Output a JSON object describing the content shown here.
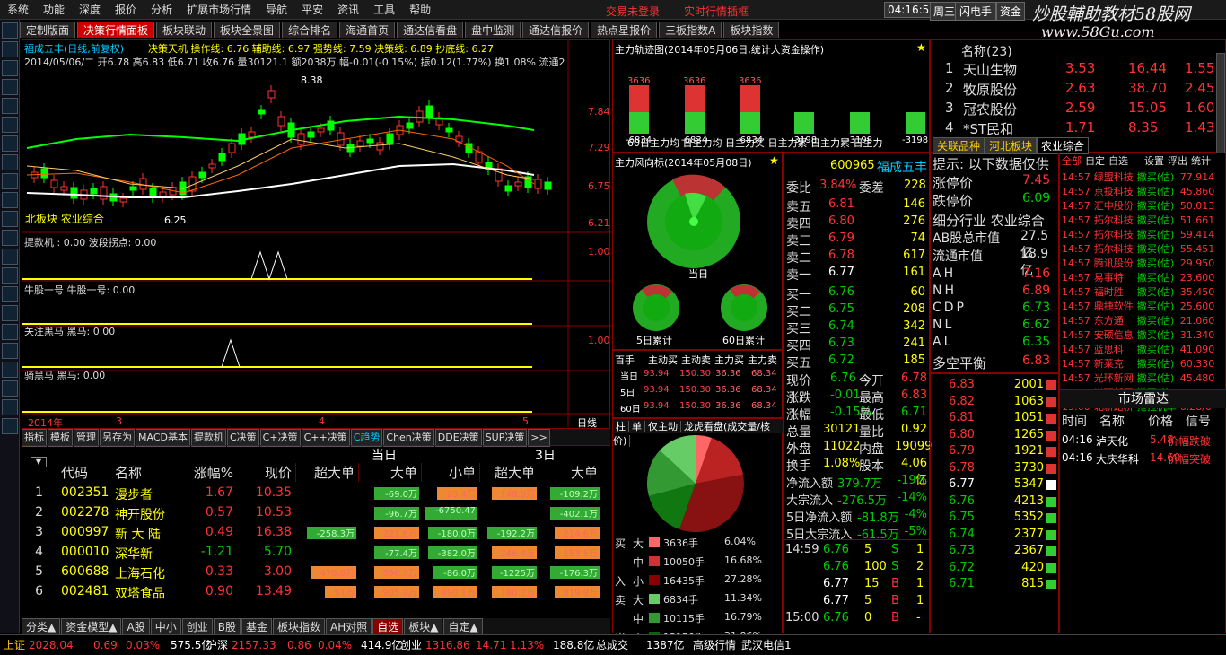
{
  "menu": [
    "系统",
    "功能",
    "深度",
    "报价",
    "分析",
    "扩展市场行情",
    "导航",
    "平安",
    "资讯",
    "工具",
    "帮助"
  ],
  "menu_red": [
    "交易未登录",
    "实时行情插框"
  ],
  "clock": "04:16:57",
  "weekday": "周三",
  "btn_flash": "闪电手",
  "btn_zi": "资金",
  "logo": "炒股輔助教材58股网",
  "logo_url": "www.58Gu.com",
  "tabs": [
    "定制版面",
    "决策行情面板",
    "板块联动",
    "板块全景图",
    "综合排名",
    "海通首页",
    "通达信看盘",
    "盘中监测",
    "通达信报价",
    "热点星报价",
    "三板指数A",
    "板块指数"
  ],
  "chart": {
    "title": "福成五丰(日线,前复权)",
    "indicators": "决策天机 操作线: 6.76 辅助线: 6.97 强势线: 7.59 决策线: 6.89 抄底线: 6.27",
    "info": "2014/05/06/二 开6.78 高6.83 低6.71 收6.76 量30121.1 额2038万 幅-0.01(-0.15%) 振0.12(1.77%) 换1.08% 流通2",
    "hi_label": "8.38",
    "lo_label": "6.25",
    "sector": "北板块 农业综合",
    "yticks": [
      "7.84",
      "7.29",
      "6.75",
      "6.21"
    ],
    "ind1": "提款机 : 0.00 波段拐点: 0.00",
    "ind1_tick": "1.00",
    "ind2": "牛股一号 牛股一号: 0.00",
    "ind3": "关注黑马 黑马: 0.00",
    "ind3_tick": "1.00",
    "ind4": "骑黑马 黑马: 0.00",
    "xlabels": [
      "2014年",
      "3",
      "4",
      "5"
    ],
    "period": "日线"
  },
  "bottom_tabs": [
    "指标",
    "模板",
    "管理",
    "另存为",
    "MACD基本",
    "提款机",
    "C决策",
    "C+决策",
    "C++决策",
    "C趋势",
    "Chen决策",
    "DDE决策",
    "SUP决策",
    ">>"
  ],
  "table": {
    "headers": [
      "代码",
      "名称",
      "涨幅%",
      "现价",
      "超大单",
      "大单",
      "小单",
      "超大单",
      "大单"
    ],
    "group_today": "当日",
    "group_3d": "3日",
    "rows": [
      {
        "n": "1",
        "code": "002351",
        "name": "漫步者",
        "pct": "1.67",
        "price": "10.35",
        "a": "",
        "b": "-69.0万",
        "c": "23.4万",
        "d": "148.0万",
        "e": "-109.2万"
      },
      {
        "n": "2",
        "code": "002278",
        "name": "神开股份",
        "pct": "0.57",
        "price": "10.53",
        "a": "",
        "b": "-96.7万",
        "c": "-6750.47",
        "d": "",
        "e": "-402.1万"
      },
      {
        "n": "3",
        "code": "000997",
        "name": "新 大 陆",
        "pct": "0.49",
        "price": "16.38",
        "a": "-258.3万",
        "b": "221.8万",
        "c": "-180.0万",
        "d": "-192.2万",
        "e": "214.6万"
      },
      {
        "n": "4",
        "code": "000010",
        "name": "深华新",
        "pct": "-1.21",
        "price": "5.70",
        "a": "",
        "b": "-77.4万",
        "c": "-382.0万",
        "d": "246.4万",
        "e": "153.5万"
      },
      {
        "n": "5",
        "code": "600688",
        "name": "上海石化",
        "pct": "0.33",
        "price": "3.00",
        "a": "470.0万",
        "b": "396.3万",
        "c": "-86.0万",
        "d": "-1225万",
        "e": "-176.3万"
      },
      {
        "n": "6",
        "code": "002481",
        "name": "双塔食品",
        "pct": "0.90",
        "price": "13.49",
        "a": "51万",
        "b": "905.2万",
        "c": "490.1万",
        "d": "180.2万",
        "e": "819.9万"
      }
    ]
  },
  "sheet_tabs": [
    "分类▲",
    "资金模型▲",
    "A股",
    "中小",
    "创业",
    "B股",
    "基金",
    "板块指数",
    "AH对照",
    "自选",
    "板块▲",
    "自定▲"
  ],
  "mainforce": {
    "title": "主力轨迹图(2014年05月06日,统计大资金操作)",
    "bars": [
      {
        "top": "3636",
        "bot": "-6834"
      },
      {
        "top": "3636",
        "bot": "-6834"
      },
      {
        "top": "3636",
        "bot": "-6834"
      },
      {
        "top": "",
        "bot": "-3198"
      },
      {
        "top": "",
        "bot": "-3198"
      },
      {
        "top": "",
        "bot": "-3198"
      }
    ],
    "labels": "60日主力均 日主力均 日主力买 日主力累 日主力累 日主力"
  },
  "wind": {
    "title": "主力风向标(2014年05月08日)",
    "today": "当日",
    "d5": "5日累计",
    "d60": "60日累计"
  },
  "flow_table": {
    "headers": [
      "百手",
      "主动买",
      "主动卖",
      "主力买",
      "主力卖"
    ],
    "rows": [
      [
        "当日",
        "93.94",
        "150.30",
        "36.36",
        "68.34"
      ],
      [
        "5日",
        "93.94",
        "150.30",
        "36.36",
        "68.34"
      ],
      [
        "60日",
        "93.94",
        "150.30",
        "36.36",
        "68.34"
      ]
    ]
  },
  "pie_tabs": [
    "柱",
    "单",
    "仅主动",
    "龙虎看盘(成交量/核价)"
  ],
  "pie_legend": [
    {
      "s": "买",
      "k": "大",
      "v": "3636手",
      "p": "6.04%",
      "c": "#f66"
    },
    {
      "s": "",
      "k": "中",
      "v": "10050手",
      "p": "16.68%",
      "c": "#c33"
    },
    {
      "s": "入",
      "k": "小",
      "v": "16435手",
      "p": "27.28%",
      "c": "#800"
    },
    {
      "s": "卖",
      "k": "大",
      "v": "6834手",
      "p": "11.34%",
      "c": "#6c6"
    },
    {
      "s": "",
      "k": "中",
      "v": "10115手",
      "p": "16.79%",
      "c": "#393"
    },
    {
      "s": "出",
      "k": "小",
      "v": "13170手",
      "p": "21.86%",
      "c": "#060"
    }
  ],
  "quote": {
    "code": "600965",
    "name": "福成五丰",
    "wb": "3.84%",
    "wc": "228",
    "sell": [
      [
        "卖五",
        "6.81",
        "146"
      ],
      [
        "卖四",
        "6.80",
        "276"
      ],
      [
        "卖三",
        "6.79",
        "74"
      ],
      [
        "卖二",
        "6.78",
        "617"
      ],
      [
        "卖一",
        "6.77",
        "161"
      ]
    ],
    "buy": [
      [
        "买一",
        "6.76",
        "60"
      ],
      [
        "买二",
        "6.75",
        "208"
      ],
      [
        "买三",
        "6.74",
        "342"
      ],
      [
        "买四",
        "6.73",
        "241"
      ],
      [
        "买五",
        "6.72",
        "185"
      ]
    ],
    "stats": [
      [
        "现价",
        "6.76",
        "今开",
        "6.78"
      ],
      [
        "涨跌",
        "-0.01",
        "最高",
        "6.83"
      ],
      [
        "涨幅",
        "-0.15%",
        "最低",
        "6.71"
      ],
      [
        "总量",
        "30121",
        "量比",
        "0.92"
      ],
      [
        "外盘",
        "11022",
        "内盘",
        "19099"
      ],
      [
        "换手",
        "1.08%",
        "股本",
        "4.06亿"
      ]
    ],
    "flows": [
      [
        "净流入额",
        "379.7万",
        "-19%"
      ],
      [
        "大宗流入",
        "-276.5万",
        "-14%"
      ],
      [
        "5日净流入额",
        "-81.8万",
        "-4%"
      ],
      [
        "5日大宗流入",
        "-61.5万",
        "-5%"
      ]
    ],
    "ticks": [
      [
        "14:59",
        "6.76",
        "5",
        "S",
        "1"
      ],
      [
        "",
        "6.76",
        "100",
        "S",
        "2"
      ],
      [
        "",
        "6.77",
        "15",
        "B",
        "1"
      ],
      [
        "",
        "6.77",
        "5",
        "B",
        "1"
      ],
      [
        "15:00",
        "6.76",
        "0",
        "B",
        "-"
      ]
    ]
  },
  "rank": {
    "title": "名称(23)",
    "rows": [
      [
        "1",
        "天山生物",
        "3.53",
        "16.44",
        "1.55"
      ],
      [
        "2",
        "牧原股份",
        "2.63",
        "38.70",
        "2.45"
      ],
      [
        "3",
        "冠农股份",
        "2.59",
        "15.05",
        "1.60"
      ],
      [
        "4",
        "*ST民和",
        "1.71",
        "8.35",
        "1.43"
      ]
    ],
    "tabs": [
      "关联品种",
      "河北板块",
      "农业综合"
    ]
  },
  "tip": {
    "title": "提示: 以下数据仅供",
    "rows": [
      [
        "涨停价",
        "7.45"
      ],
      [
        "跌停价",
        "6.09"
      ]
    ],
    "industry": "细分行业 农业综合",
    "ab": "AB股总市值",
    "ab_v": "27.5亿",
    "lt": "流通市值",
    "lt_v": "18.9亿",
    "ind": [
      [
        "AH",
        "7.16"
      ],
      [
        "NH",
        "6.89"
      ],
      [
        "CDP",
        "6.73"
      ],
      [
        "NL",
        "6.62"
      ],
      [
        "AL",
        "6.35"
      ]
    ],
    "balance": "多空平衡",
    "balance_v": "6.83"
  },
  "depth": [
    [
      "6.83",
      "2001"
    ],
    [
      "6.82",
      "1063"
    ],
    [
      "6.81",
      "1051"
    ],
    [
      "6.80",
      "1265"
    ],
    [
      "6.79",
      "1921"
    ],
    [
      "6.78",
      "3730"
    ],
    [
      "6.77",
      "5347"
    ],
    [
      "6.76",
      "4213"
    ],
    [
      "6.75",
      "5352"
    ],
    [
      "6.74",
      "2377"
    ],
    [
      "6.73",
      "2367"
    ],
    [
      "6.72",
      "420"
    ],
    [
      "6.71",
      "815"
    ]
  ],
  "news_tabs": [
    "全部",
    "自定",
    "自选",
    "设置",
    "浮出",
    "统计"
  ],
  "news": [
    [
      "14:57",
      "绿盟科技",
      "撤买(估)",
      "77.914"
    ],
    [
      "14:57",
      "京投科技",
      "撤买(估)",
      "45.860"
    ],
    [
      "14:57",
      "汇中股份",
      "撤买(估)",
      "50.013"
    ],
    [
      "14:57",
      "拓尔科技",
      "撤买(估)",
      "51.661"
    ],
    [
      "14:57",
      "拓尔科技",
      "撤买(估)",
      "59.414"
    ],
    [
      "14:57",
      "拓尔科技",
      "撤买(估)",
      "55.451"
    ],
    [
      "14:57",
      "腾讯股份",
      "撤买(估)",
      "29.950"
    ],
    [
      "14:57",
      "易事特",
      "撤买(估)",
      "23.600"
    ],
    [
      "14:57",
      "福时胜",
      "撤买(估)",
      "35.450"
    ],
    [
      "14:57",
      "鼎捷软件",
      "撤买(估)",
      "25.600"
    ],
    [
      "14:57",
      "东方通",
      "撤买(估)",
      "21.060"
    ],
    [
      "14:57",
      "安硕信息",
      "撤买(估)",
      "31.340"
    ],
    [
      "14:57",
      "蓝思科",
      "撤买(估)",
      "41.090"
    ],
    [
      "14:57",
      "新莱克",
      "撤买(估)",
      "60.330"
    ],
    [
      "14:57",
      "光环新网",
      "撤买(估)",
      "45.480"
    ],
    [
      "14:57",
      "光环新网",
      "撤买(估)",
      "49.295"
    ],
    [
      "15:00",
      "北新路桥",
      "拖拉机单",
      "6.28/0"
    ]
  ],
  "radar": {
    "title": "市场雷达",
    "headers": [
      "时间",
      "名称",
      "价格",
      "信号"
    ],
    "rows": [
      [
        "04:16",
        "泸天化",
        "5.48",
        "价幅跌破"
      ],
      [
        "04:16",
        "大庆华科",
        "14.60",
        "价幅突破"
      ]
    ]
  },
  "status": {
    "sh": "上证",
    "sh_v": "2028.04",
    "sh_c": "0.69",
    "sh_p": "0.03%",
    "sh_a": "575.5亿",
    "hs": "沪深",
    "hs_v": "2157.33",
    "hs_c": "0.86",
    "hs_p": "0.04%",
    "hs_a": "414.9亿",
    "cy": "创业",
    "cy_v": "1316.86",
    "cy_c": "14.71",
    "cy_p": "1.13%",
    "cy_a": "188.8亿",
    "zc": "总成交",
    "zc_v": "1387亿",
    "server": "高级行情_武汉电信1"
  }
}
